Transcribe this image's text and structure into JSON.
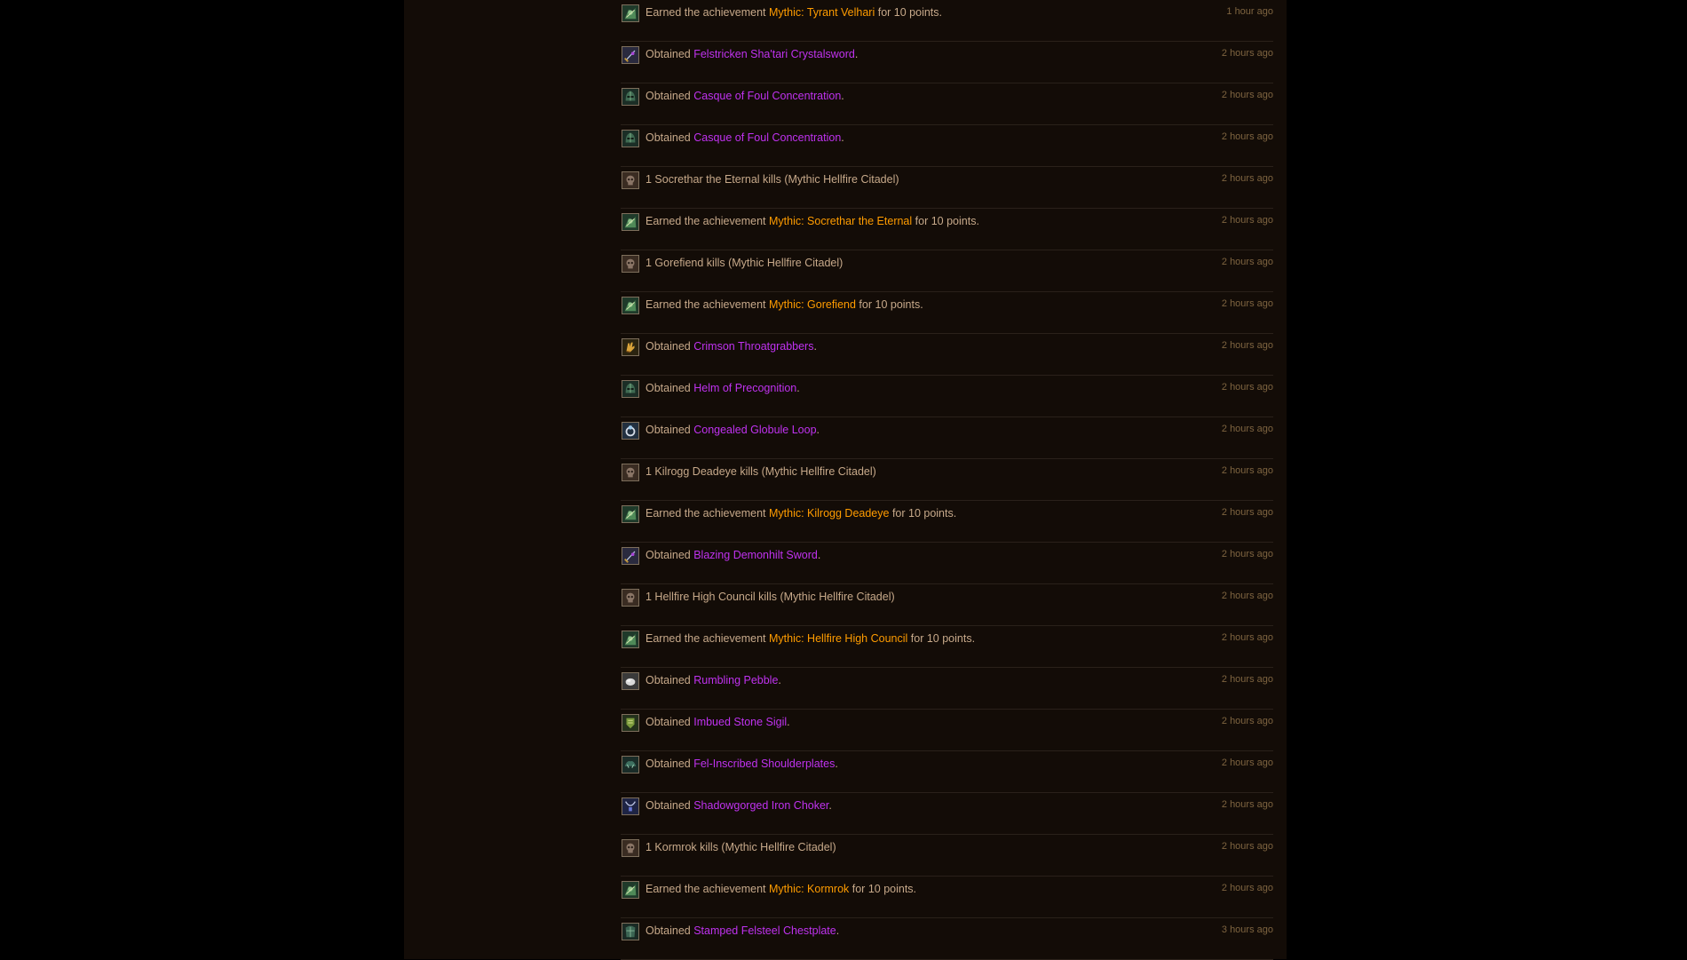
{
  "colors": {
    "background": "#000000",
    "panel": "#130c07",
    "text": "#c7a98a",
    "achievement_link": "#ff9c00",
    "item_link": "#c032f0",
    "timestamp": "#7e6440",
    "divider": "#2a211a"
  },
  "feed": [
    {
      "type": "achievement",
      "icon": "achievement-icon",
      "prefix": "Earned the achievement ",
      "link": "Mythic: Tyrant Velhari",
      "suffix": " for 10 points.",
      "time": "1 hour ago"
    },
    {
      "type": "item",
      "icon": "sword-icon",
      "prefix": "Obtained ",
      "link": "Felstricken Sha'tari Crystalsword",
      "suffix": ".",
      "time": "2 hours ago"
    },
    {
      "type": "item",
      "icon": "helm-icon",
      "prefix": "Obtained ",
      "link": "Casque of Foul Concentration",
      "suffix": ".",
      "time": "2 hours ago"
    },
    {
      "type": "item",
      "icon": "helm-icon",
      "prefix": "Obtained ",
      "link": "Casque of Foul Concentration",
      "suffix": ".",
      "time": "2 hours ago"
    },
    {
      "type": "kill",
      "icon": "skull-icon",
      "prefix": "1 Socrethar the Eternal kills (Mythic Hellfire Citadel)",
      "link": "",
      "suffix": "",
      "time": "2 hours ago"
    },
    {
      "type": "achievement",
      "icon": "achievement-icon",
      "prefix": "Earned the achievement ",
      "link": "Mythic: Socrethar the Eternal",
      "suffix": " for 10 points.",
      "time": "2 hours ago"
    },
    {
      "type": "kill",
      "icon": "skull-icon",
      "prefix": "1 Gorefiend kills (Mythic Hellfire Citadel)",
      "link": "",
      "suffix": "",
      "time": "2 hours ago"
    },
    {
      "type": "achievement",
      "icon": "achievement-icon",
      "prefix": "Earned the achievement ",
      "link": "Mythic: Gorefiend",
      "suffix": " for 10 points.",
      "time": "2 hours ago"
    },
    {
      "type": "item",
      "icon": "gloves-icon",
      "prefix": "Obtained ",
      "link": "Crimson Throatgrabbers",
      "suffix": ".",
      "time": "2 hours ago"
    },
    {
      "type": "item",
      "icon": "helm-icon",
      "prefix": "Obtained ",
      "link": "Helm of Precognition",
      "suffix": ".",
      "time": "2 hours ago"
    },
    {
      "type": "item",
      "icon": "ring-icon",
      "prefix": "Obtained ",
      "link": "Congealed Globule Loop",
      "suffix": ".",
      "time": "2 hours ago"
    },
    {
      "type": "kill",
      "icon": "skull-icon",
      "prefix": "1 Kilrogg Deadeye kills (Mythic Hellfire Citadel)",
      "link": "",
      "suffix": "",
      "time": "2 hours ago"
    },
    {
      "type": "achievement",
      "icon": "achievement-icon",
      "prefix": "Earned the achievement ",
      "link": "Mythic: Kilrogg Deadeye",
      "suffix": " for 10 points.",
      "time": "2 hours ago"
    },
    {
      "type": "item",
      "icon": "sword-icon",
      "prefix": "Obtained ",
      "link": "Blazing Demonhilt Sword",
      "suffix": ".",
      "time": "2 hours ago"
    },
    {
      "type": "kill",
      "icon": "skull-icon",
      "prefix": "1 Hellfire High Council kills (Mythic Hellfire Citadel)",
      "link": "",
      "suffix": "",
      "time": "2 hours ago"
    },
    {
      "type": "achievement",
      "icon": "achievement-icon",
      "prefix": "Earned the achievement ",
      "link": "Mythic: Hellfire High Council",
      "suffix": " for 10 points.",
      "time": "2 hours ago"
    },
    {
      "type": "item",
      "icon": "pebble-icon",
      "prefix": "Obtained ",
      "link": "Rumbling Pebble",
      "suffix": ".",
      "time": "2 hours ago"
    },
    {
      "type": "item",
      "icon": "sigil-icon",
      "prefix": "Obtained ",
      "link": "Imbued Stone Sigil",
      "suffix": ".",
      "time": "2 hours ago"
    },
    {
      "type": "item",
      "icon": "shoulder-icon",
      "prefix": "Obtained ",
      "link": "Fel-Inscribed Shoulderplates",
      "suffix": ".",
      "time": "2 hours ago"
    },
    {
      "type": "item",
      "icon": "necklace-icon",
      "prefix": "Obtained ",
      "link": "Shadowgorged Iron Choker",
      "suffix": ".",
      "time": "2 hours ago"
    },
    {
      "type": "kill",
      "icon": "skull-icon",
      "prefix": "1 Kormrok kills (Mythic Hellfire Citadel)",
      "link": "",
      "suffix": "",
      "time": "2 hours ago"
    },
    {
      "type": "achievement",
      "icon": "achievement-icon",
      "prefix": "Earned the achievement ",
      "link": "Mythic: Kormrok",
      "suffix": " for 10 points.",
      "time": "2 hours ago"
    },
    {
      "type": "item",
      "icon": "chest-icon",
      "prefix": "Obtained ",
      "link": "Stamped Felsteel Chestplate",
      "suffix": ".",
      "time": "3 hours ago"
    }
  ]
}
